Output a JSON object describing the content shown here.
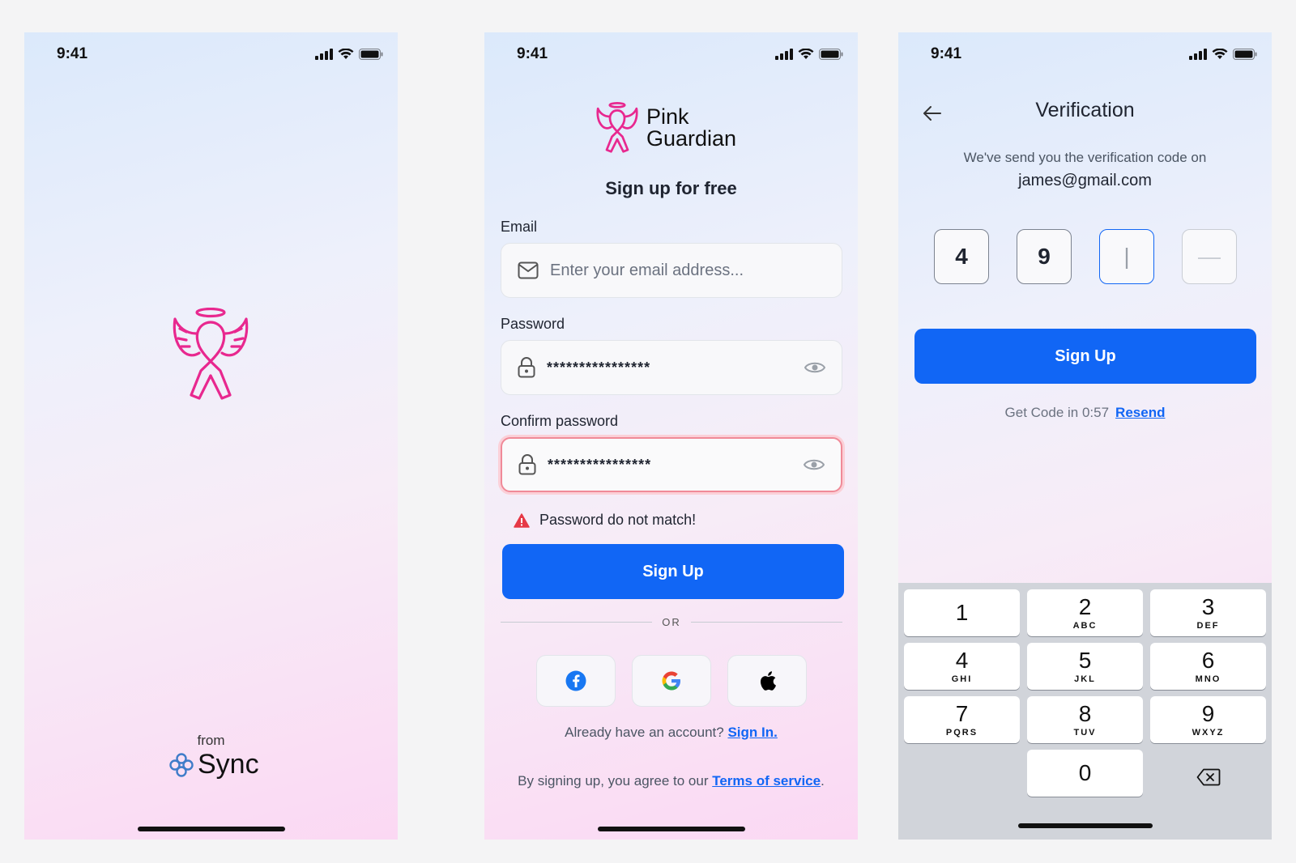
{
  "status_time": "9:41",
  "splash": {
    "from_label": "from",
    "brand_name": "Sync"
  },
  "signup": {
    "app_name_line1": "Pink",
    "app_name_line2": "Guardian",
    "heading": "Sign up for free",
    "email_label": "Email",
    "email_placeholder": "Enter your email address...",
    "password_label": "Password",
    "password_value": "****************",
    "confirm_label": "Confirm password",
    "confirm_value": "****************",
    "error_message": "Password do not match!",
    "signup_button": "Sign Up",
    "or_label": "OR",
    "social": [
      "facebook-icon",
      "google-icon",
      "apple-icon"
    ],
    "already_text": "Already have an account?",
    "signin_link": "Sign In.",
    "terms_text": "By signing  up, you agree to our",
    "terms_link": "Terms of service",
    "terms_end": ".",
    "error_color": "#f08a98",
    "accent": "#1166f5",
    "logo_color": "#e8288f"
  },
  "verification": {
    "title": "Verification",
    "subtitle": "We've send you the verification code on",
    "email": "james@gmail.com",
    "code_digits": [
      "4",
      "9",
      "|",
      "—"
    ],
    "signup_button": "Sign Up",
    "timer_text": "Get Code in 0:57",
    "resend_link": "Resend"
  },
  "keypad": {
    "keys": [
      {
        "digit": "1",
        "letters": ""
      },
      {
        "digit": "2",
        "letters": "ABC"
      },
      {
        "digit": "3",
        "letters": "DEF"
      },
      {
        "digit": "4",
        "letters": "GHI"
      },
      {
        "digit": "5",
        "letters": "JKL"
      },
      {
        "digit": "6",
        "letters": "MNO"
      },
      {
        "digit": "7",
        "letters": "PQRS"
      },
      {
        "digit": "8",
        "letters": "TUV"
      },
      {
        "digit": "9",
        "letters": "WXYZ"
      },
      {
        "digit": "0",
        "letters": ""
      }
    ]
  }
}
